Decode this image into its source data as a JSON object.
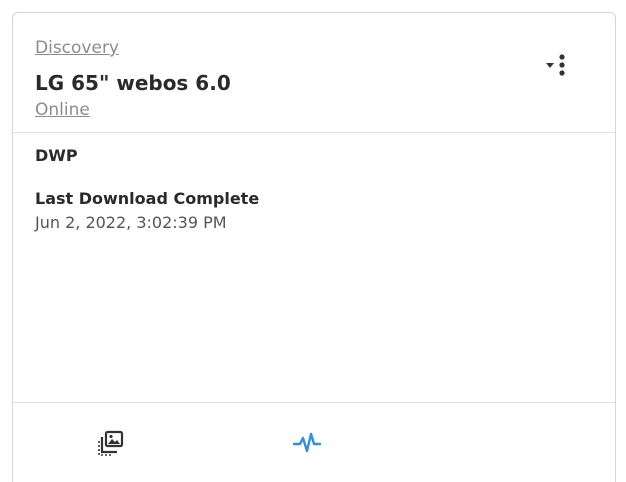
{
  "header": {
    "breadcrumb": "Discovery",
    "device_name": "LG 65\" webos 6.0",
    "status": "Online"
  },
  "content": {
    "section_label": "DWP",
    "download_label": "Last Download Complete",
    "download_time": "Jun 2, 2022, 3:02:39 PM"
  },
  "footer": {
    "icons": [
      "gallery-icon",
      "activity-icon"
    ]
  },
  "colors": {
    "accent": "#2f8fe0",
    "muted_text": "#8c8c8c",
    "border": "#d6d6d6"
  }
}
